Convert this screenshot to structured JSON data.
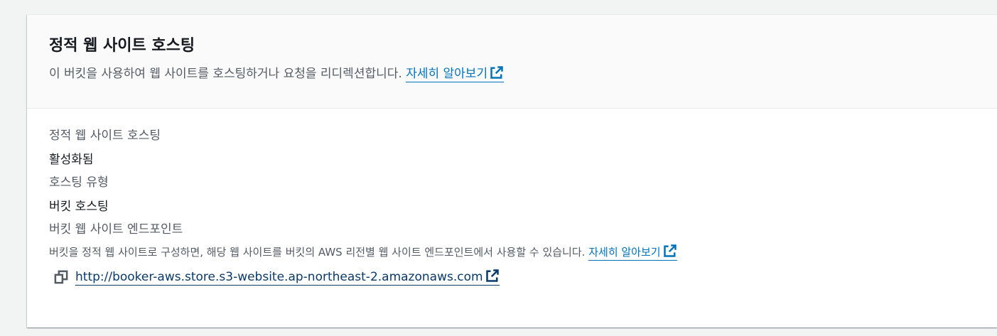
{
  "section": {
    "title": "정적 웹 사이트 호스팅",
    "description": "이 버킷을 사용하여 웹 사이트를 호스팅하거나 요청을 리디렉션합니다.",
    "learn_more": "자세히 알아보기"
  },
  "fields": {
    "hosting_label": "정적 웹 사이트 호스팅",
    "hosting_value": "활성화됨",
    "type_label": "호스팅 유형",
    "type_value": "버킷 호스팅",
    "endpoint_label": "버킷 웹 사이트 엔드포인트",
    "endpoint_desc": "버킷을 정적 웹 사이트로 구성하면, 해당 웹 사이트를 버킷의 AWS 리전별 웹 사이트 엔드포인트에서 사용할 수 있습니다.",
    "endpoint_learn_more": "자세히 알아보기",
    "endpoint_url": "http://booker-aws.store.s3-website.ap-northeast-2.amazonaws.com"
  },
  "icons": {
    "external": "external-link-icon",
    "copy": "copy-icon"
  },
  "colors": {
    "link": "#0073bb",
    "link_dark": "#0a3a6a",
    "secondary_text": "#545b64",
    "primary_text": "#16191f"
  }
}
